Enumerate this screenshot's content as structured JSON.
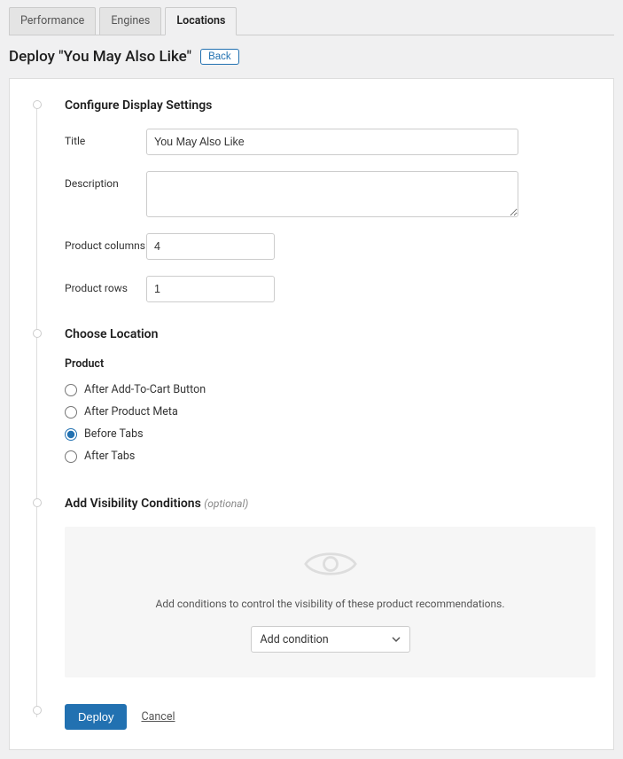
{
  "tabs": {
    "performance": "Performance",
    "engines": "Engines",
    "locations": "Locations"
  },
  "header": {
    "title": "Deploy \"You May Also Like\"",
    "back_label": "Back"
  },
  "steps": {
    "configure": {
      "title": "Configure Display Settings",
      "fields": {
        "title_label": "Title",
        "title_value": "You May Also Like",
        "description_label": "Description",
        "description_value": "",
        "columns_label": "Product columns",
        "columns_value": "4",
        "rows_label": "Product rows",
        "rows_value": "1"
      }
    },
    "location": {
      "title": "Choose Location",
      "group_heading": "Product",
      "options": {
        "after_addtocart": "After Add-To-Cart Button",
        "after_meta": "After Product Meta",
        "before_tabs": "Before Tabs",
        "after_tabs": "After Tabs"
      }
    },
    "visibility": {
      "title": "Add Visibility Conditions",
      "optional": "(optional)",
      "help_text": "Add conditions to control the visibility of these product recommendations.",
      "add_condition_label": "Add condition"
    }
  },
  "actions": {
    "deploy": "Deploy",
    "cancel": "Cancel"
  }
}
